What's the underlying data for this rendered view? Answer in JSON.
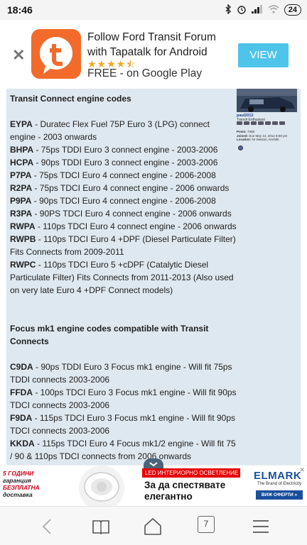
{
  "status": {
    "time": "18:46",
    "battery": "24"
  },
  "promo": {
    "title": "Follow Ford Transit Forum with Tapatalk for Android",
    "stars": "★★★★⯪",
    "subtitle": "FREE - on Google Play",
    "button": "VIEW",
    "close_icon": "close-icon",
    "logo_letter": "t"
  },
  "post": {
    "section1_heading": "Transit Connect engine codes",
    "section1_items": [
      {
        "code": "EYPA",
        "desc": " - Duratec Flex Fuel 75P Euro 3 (LPG) connect engine - 2003 onwards"
      },
      {
        "code": "BHPA",
        "desc": " - 75ps TDDI Euro 3 connect engine - 2003-2006"
      },
      {
        "code": "HCPA",
        "desc": " - 90ps TDDI Euro 3 connect engine - 2003-2006"
      },
      {
        "code": "P7PA",
        "desc": " - 75ps TDCI Euro 4 connect engine - 2006-2008"
      },
      {
        "code": "R2PA",
        "desc": " - 75ps TDCI Euro 4 connect engine - 2006 onwards"
      },
      {
        "code": "P9PA",
        "desc": " - 90ps TDCI Euro 4 connect engine - 2006-2008"
      },
      {
        "code": "R3PA",
        "desc": " - 90PS TDCI Euro 4 connect engine - 2006 onwards"
      },
      {
        "code": "RWPA",
        "desc": " - 110ps TDCI Euro 4 connect engine - 2006 onwards"
      },
      {
        "code": "RWPB",
        "desc": " - 110ps TDCI Euro 4 +DPF (Diesel Particulate Filter) Fits Connects from 2009-2011"
      },
      {
        "code": "RWPC",
        "desc": " - 110ps TDCI Euro 5 +cDPF (Catalytic Diesel Particulate Filter) Fits Connects from 2011-2013 (Also used on very late Euro 4 +DPF Connect models)"
      }
    ],
    "section2_heading": "Focus mk1 engine codes compatible with Transit Connects",
    "section2_items": [
      {
        "code": "C9DA",
        "desc": " - 90ps TDDI Euro 3 Focus mk1 engine - Will fit 75ps TDDI connects 2003-2006"
      },
      {
        "code": "FFDA",
        "desc": " - 100ps TDCI Euro 3 Focus mk1 engine - Will fit 90ps TDCI connects 2003-2006"
      },
      {
        "code": "F9DA",
        "desc": " - 115ps TDCI Euro 3 Focus mk1 engine - Will fit 90ps TDCI connects 2003-2006"
      },
      {
        "code": "KKDA",
        "desc": " - 115ps TDCI Euro 4 Focus mk1/2 engine - Will fit 75 / 90 & 110ps TDCI connects from 2006 onwards"
      }
    ]
  },
  "user": {
    "name": "paul2012",
    "rank": "Transit Enthusiast",
    "posts_label": "Posts:",
    "posts": "7368",
    "joined_label": "Joined:",
    "joined": "Sun May 13, 2012 8:59 pm",
    "location_label": "Location:",
    "location": "Nr Weston, Norfolk"
  },
  "ad": {
    "left_line1": "5 ГОДИНИ",
    "left_line2": "гаранция",
    "left_line3": "БЕЗПЛАТНА",
    "left_line4": "доставка",
    "banner": "LED ИНТЕРИОРНО ОСВЕТЛЕНИЕ",
    "headline": "За да спестявате елегантно",
    "brand": "ELMARK",
    "brand_sub": "The Brand of Electricity",
    "cta": "ВИЖ ОФЕРТИ »",
    "close": "✕"
  },
  "nav": {
    "tabs_count": "7"
  }
}
